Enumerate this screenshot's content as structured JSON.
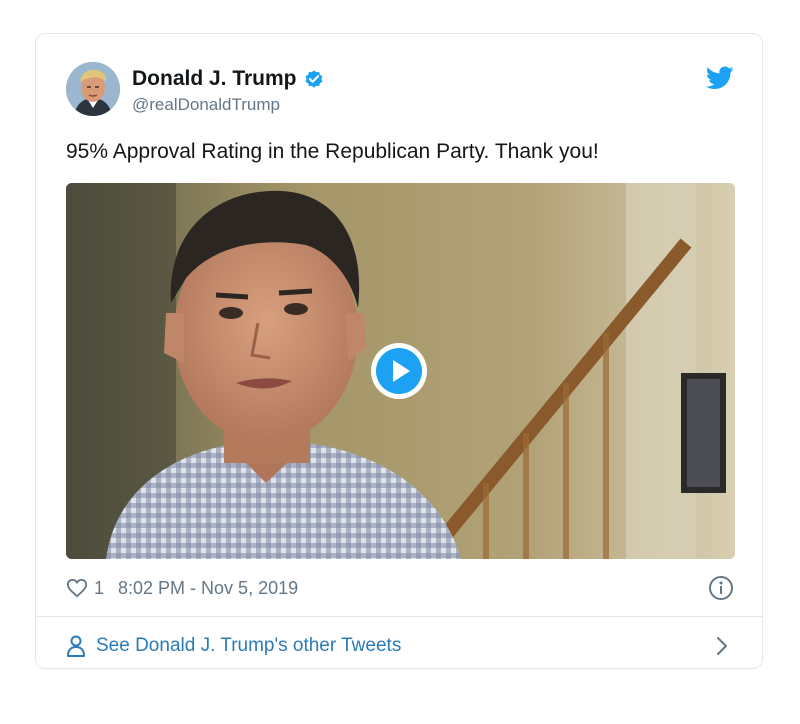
{
  "tweet": {
    "author": {
      "display_name": "Donald J. Trump",
      "handle": "@realDonaldTrump",
      "verified": true,
      "avatar_icon": "profile-photo"
    },
    "logo_icon": "twitter-bird-icon",
    "text": "95% Approval Rating in the Republican Party. Thank you!",
    "media": {
      "type": "video",
      "play_icon": "play-icon"
    },
    "likes": "1",
    "timestamp": "8:02 PM - Nov 5, 2019",
    "info_icon": "info-icon",
    "footer": {
      "label": "See Donald J. Trump's other Tweets",
      "icon": "person-icon",
      "chevron_icon": "chevron-right-icon"
    }
  },
  "colors": {
    "link": "#2b7bb9",
    "twitter_blue": "#1da1f2",
    "muted": "#657786",
    "border": "#e1e8ed"
  }
}
